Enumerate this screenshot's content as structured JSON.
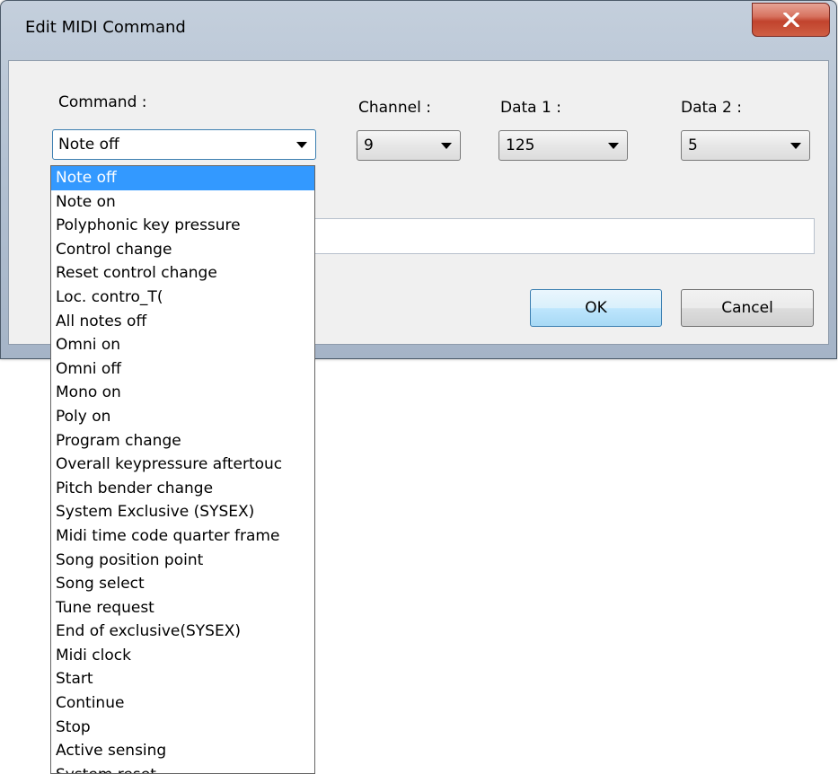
{
  "window": {
    "title": "Edit MIDI Command"
  },
  "labels": {
    "command": "Command :",
    "channel": "Channel :",
    "data1": "Data 1 :",
    "data2": "Data 2 :"
  },
  "combos": {
    "command": "Note off",
    "channel": "9",
    "data1": "125",
    "data2": "5"
  },
  "buttons": {
    "ok": "OK",
    "cancel": "Cancel"
  },
  "dropdown": {
    "items": [
      "Note off",
      "Note on",
      "Polyphonic key pressure",
      "Control change",
      "Reset control change",
      "Loc. contro_T(",
      "All notes off",
      "Omni on",
      "Omni off",
      "Mono on",
      "Poly on",
      "Program change",
      "Overall keypressure aftertouc",
      "Pitch bender change",
      "System Exclusive (SYSEX)",
      "Midi time code quarter frame",
      "Song position point",
      "Song select",
      "Tune request",
      "End of exclusive(SYSEX)",
      "Midi clock",
      "Start",
      "Continue",
      "Stop",
      "Active sensing",
      "System reset"
    ],
    "selected_index": 0
  },
  "icons": {
    "close": "close-icon",
    "dropdown_arrow": "chevron-down-icon"
  },
  "colors": {
    "selection": "#3399ff",
    "close_button": "#c7432e"
  }
}
